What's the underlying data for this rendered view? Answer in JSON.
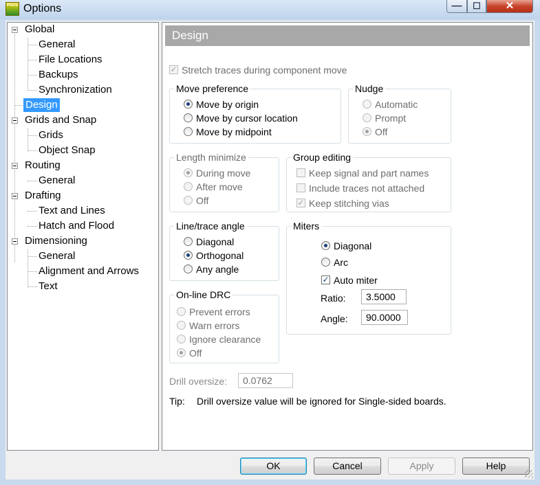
{
  "window": {
    "title": "Options",
    "icon_text": "PADS"
  },
  "tree": {
    "nodes": [
      {
        "label": "Global"
      },
      {
        "label": "General"
      },
      {
        "label": "File Locations"
      },
      {
        "label": "Backups"
      },
      {
        "label": "Synchronization"
      },
      {
        "label": "Design"
      },
      {
        "label": "Grids and Snap"
      },
      {
        "label": "Grids"
      },
      {
        "label": "Object Snap"
      },
      {
        "label": "Routing"
      },
      {
        "label": "General"
      },
      {
        "label": "Drafting"
      },
      {
        "label": "Text and Lines"
      },
      {
        "label": "Hatch and Flood"
      },
      {
        "label": "Dimensioning"
      },
      {
        "label": "General"
      },
      {
        "label": "Alignment and Arrows"
      },
      {
        "label": "Text"
      }
    ],
    "selected": "Design"
  },
  "panel": {
    "title": "Design",
    "stretch_traces": {
      "label": "Stretch traces during component move",
      "checked": true,
      "enabled": false
    },
    "move_preference": {
      "title": "Move preference",
      "options": [
        "Move by origin",
        "Move by cursor location",
        "Move by midpoint"
      ],
      "selected": "Move by origin"
    },
    "nudge": {
      "title": "Nudge",
      "options": [
        "Automatic",
        "Prompt",
        "Off"
      ],
      "selected": "Off",
      "enabled": false
    },
    "length_minimize": {
      "title": "Length minimize",
      "options": [
        "During move",
        "After move",
        "Off"
      ],
      "selected": "During move",
      "enabled": false
    },
    "group_editing": {
      "title": "Group editing",
      "options": [
        {
          "label": "Keep signal and part names",
          "checked": false
        },
        {
          "label": "Include traces not attached",
          "checked": false
        },
        {
          "label": "Keep stitching vias",
          "checked": true
        }
      ],
      "enabled": false
    },
    "line_trace_angle": {
      "title": "Line/trace angle",
      "options": [
        "Diagonal",
        "Orthogonal",
        "Any angle"
      ],
      "selected": "Orthogonal"
    },
    "miters": {
      "title": "Miters",
      "options": [
        "Diagonal",
        "Arc"
      ],
      "selected": "Diagonal",
      "auto_miter": {
        "label": "Auto miter",
        "checked": true
      },
      "ratio": {
        "label": "Ratio:",
        "value": "3.5000"
      },
      "angle": {
        "label": "Angle:",
        "value": "90.0000"
      }
    },
    "online_drc": {
      "title": "On-line DRC",
      "options": [
        "Prevent errors",
        "Warn errors",
        "Ignore clearance",
        "Off"
      ],
      "selected": "Off",
      "enabled": false
    },
    "drill_oversize": {
      "label": "Drill oversize:",
      "value": "0.0762",
      "enabled": false
    },
    "tip": {
      "label": "Tip:",
      "text": "Drill oversize value will be ignored for Single-sided boards."
    }
  },
  "buttons": {
    "ok": "OK",
    "cancel": "Cancel",
    "apply": "Apply",
    "help": "Help"
  }
}
